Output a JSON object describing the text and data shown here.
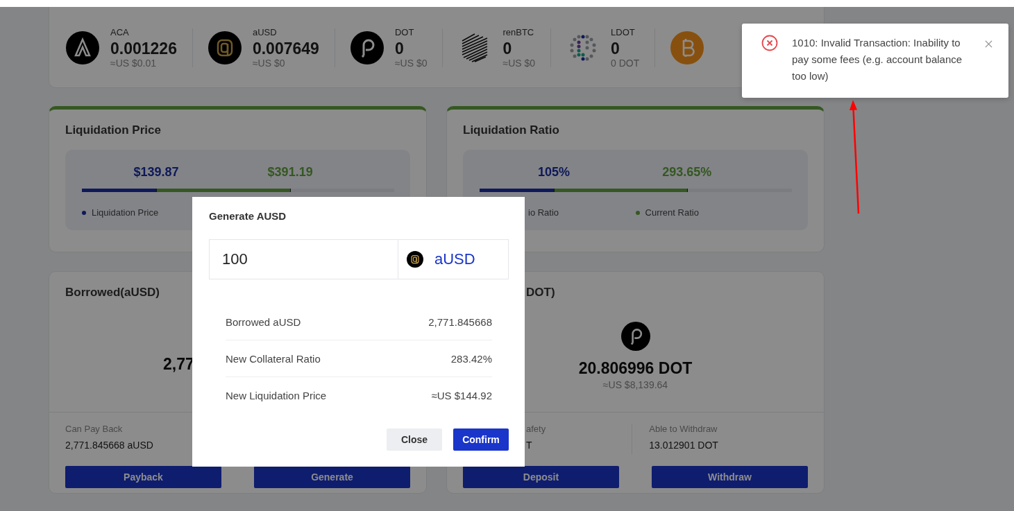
{
  "assets": [
    {
      "kind": "aca",
      "name": "ACA",
      "amount": "0.001226",
      "value": "≈US $0.01"
    },
    {
      "kind": "ausd",
      "name": "aUSD",
      "amount": "0.007649",
      "value": "≈US $0"
    },
    {
      "kind": "dot",
      "name": "DOT",
      "amount": "0",
      "value": "≈US $0"
    },
    {
      "kind": "renbtc",
      "name": "renBTC",
      "amount": "0",
      "value": "≈US $0"
    },
    {
      "kind": "ldot",
      "name": "LDOT",
      "amount": "0",
      "value": "0 DOT"
    },
    {
      "kind": "btc"
    }
  ],
  "liquidation_cards": [
    {
      "title": "Liquidation Price",
      "markers": [
        {
          "label": "$139.87",
          "level": 0.238
        },
        {
          "label": "$391.19",
          "level": 0.667
        }
      ],
      "legend": [
        {
          "label": "Liquidation Price",
          "dot": true
        }
      ]
    },
    {
      "title": "Liquidation Ratio",
      "markers": [
        {
          "label": "105%",
          "level": 0.238
        },
        {
          "label": "293.65%",
          "level": 0.664
        }
      ],
      "legend": [
        {
          "label": "io Ratio",
          "dot": false
        },
        {
          "label": "Current Ratio",
          "dot": true
        }
      ]
    }
  ],
  "balance_cards": [
    {
      "title": "Borrowed(aUSD)",
      "amount": "2,77",
      "stats": [
        {
          "label": "Can Pay Back",
          "value": "2,771.845668 aUSD"
        }
      ],
      "buttons": [
        "Payback",
        "Generate"
      ]
    },
    {
      "title": "DOT)",
      "kind": "dot",
      "amount": "20.806996 DOT",
      "value": "≈US $8,139.64",
      "stats": [
        {
          "label": "afety",
          "value": "T"
        },
        {
          "label": "Able to Withdraw",
          "value": "13.012901 DOT"
        }
      ],
      "buttons": [
        "Deposit",
        "Withdraw"
      ]
    }
  ],
  "modal": {
    "title": "Generate AUSD",
    "amount_input": {
      "value": "100"
    },
    "token": {
      "kind": "ausd",
      "label": "aUSD"
    },
    "rows": [
      {
        "label": "Borrowed aUSD",
        "value": "2,771.845668"
      },
      {
        "label": "New Collateral Ratio",
        "value": "283.42%"
      },
      {
        "label": "New Liquidation Price",
        "value": "≈US $144.92"
      }
    ],
    "buttons": [
      {
        "label": "Close",
        "kind": "secondary"
      },
      {
        "label": "Confirm",
        "kind": "primary"
      }
    ]
  },
  "toast": {
    "kind": "error",
    "message": "1010: Invalid Transaction: Inability to pay some fees (e.g. account balance too low)"
  }
}
